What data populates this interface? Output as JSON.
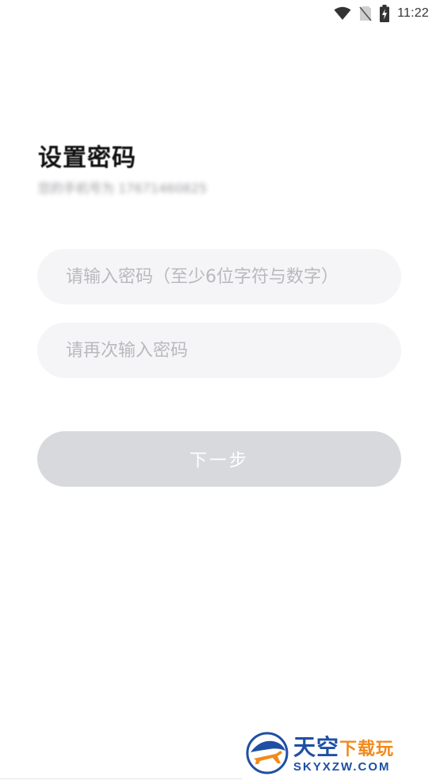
{
  "status_bar": {
    "time": "11:22",
    "icons": [
      "wifi-icon",
      "no-sim-icon",
      "battery-charging-icon"
    ]
  },
  "header": {
    "title": "设置密码",
    "subtitle": "您的手机号为 17671460825"
  },
  "form": {
    "password_placeholder": "请输入密码（至少6位字符与数字）",
    "password_value": "",
    "confirm_placeholder": "请再次输入密码",
    "confirm_value": "",
    "next_label": "下一步"
  },
  "watermark": {
    "cn_main": "天空",
    "cn_sub": "下载玩",
    "en": "SKYXZW.COM"
  },
  "colors": {
    "input_bg": "#f5f5f7",
    "button_disabled": "#d8d9dd",
    "placeholder": "#b9b9be",
    "brand_blue": "#1f4fa3",
    "brand_orange": "#f08a1c"
  }
}
